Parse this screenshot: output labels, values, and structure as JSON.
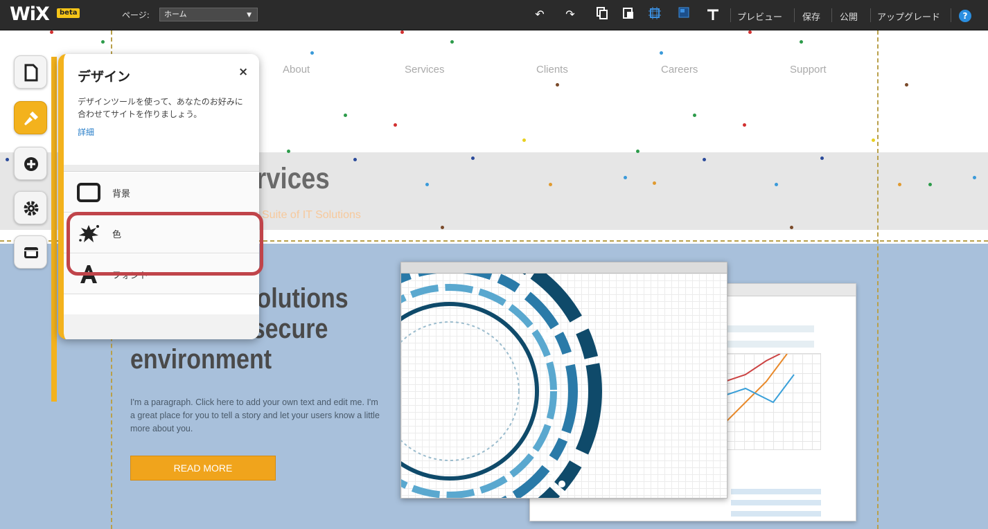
{
  "topbar": {
    "logo": "WiX",
    "beta_badge": "beta",
    "page_label": "ページ:",
    "page_select_value": "ホーム",
    "preview": "プレビュー",
    "save": "保存",
    "publish": "公開",
    "upgrade": "アップグレード",
    "help": "?",
    "icons": [
      "undo-icon",
      "redo-icon",
      "copy-icon",
      "paste-icon",
      "grid-icon",
      "snap-icon",
      "ruler-icon",
      "help-icon"
    ]
  },
  "site": {
    "nav": [
      "About",
      "Services",
      "Clients",
      "Careers",
      "Support"
    ],
    "services_title": "rvices",
    "services_subtitle": "Suite of IT Solutions",
    "hero_lines": [
      "Solutions",
      "for a more secure",
      "environment"
    ],
    "paragraph": "I'm a paragraph. Click here to add your own text and edit me. I'm a great place for you to tell a story and let your users know a little more about you.",
    "read_more": "READ MORE"
  },
  "rail": {
    "items": [
      "pages-icon",
      "design-icon",
      "add-icon",
      "settings-icon",
      "store-icon"
    ],
    "active": "design-icon"
  },
  "design_panel": {
    "title": "デザイン",
    "close": "×",
    "description": "デザインツールを使って、あなたのお好みに合わせてサイトを作りましょう。",
    "learn_more": "詳細",
    "items": [
      {
        "label": "背景",
        "icon": "background-icon"
      },
      {
        "label": "色",
        "icon": "color-splash-icon"
      },
      {
        "label": "フォント",
        "icon": "font-icon"
      }
    ],
    "highlighted_item": "色"
  },
  "colors": {
    "accent": "#f3b21d",
    "highlight": "#c0444a",
    "topbar": "#2b2b2b",
    "hero_bg": "#a8c0db",
    "button": "#f0a41c"
  }
}
